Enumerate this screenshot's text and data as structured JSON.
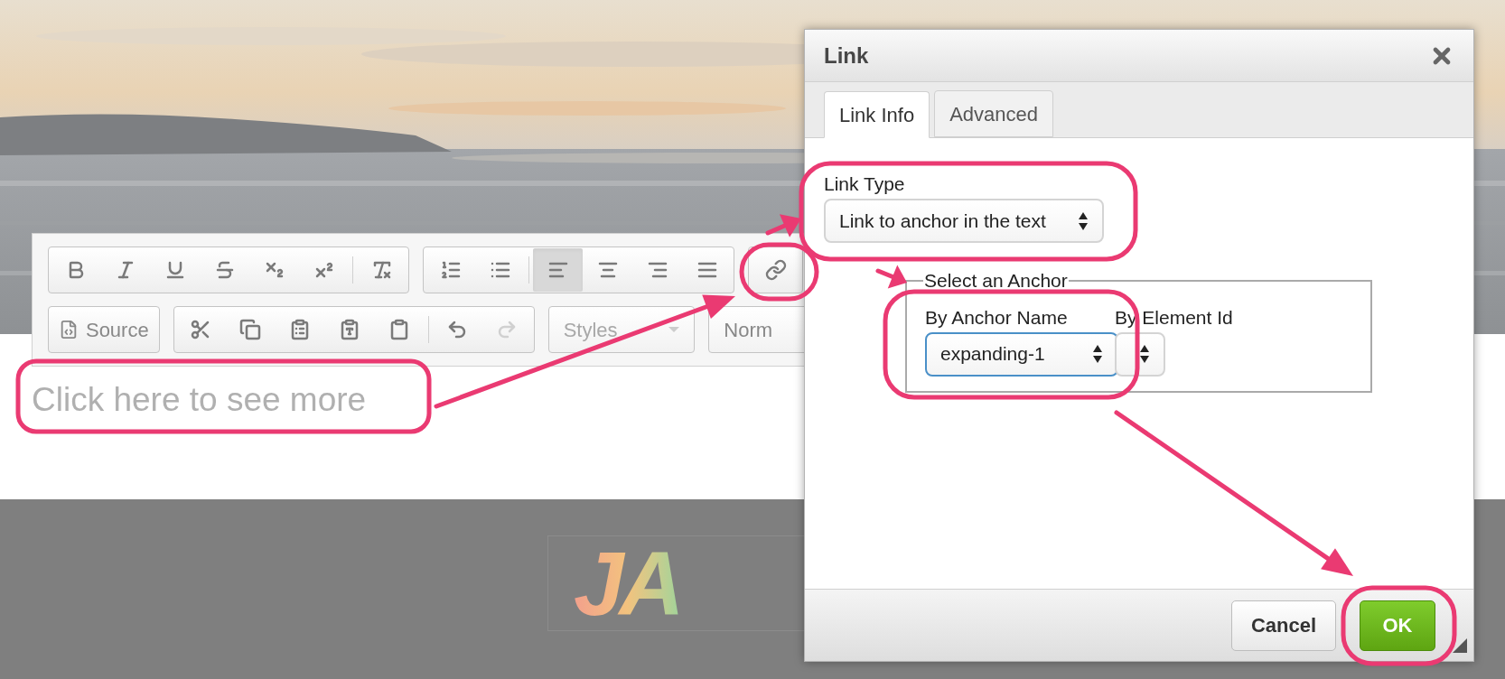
{
  "editor": {
    "toolbar_rows": [
      [
        {
          "items": [
            {
              "kind": "bold",
              "selected": false,
              "disabled": false
            },
            {
              "kind": "italic",
              "selected": false,
              "disabled": false
            },
            {
              "kind": "underline",
              "selected": false,
              "disabled": false
            },
            {
              "kind": "strike",
              "selected": false,
              "disabled": false
            },
            {
              "kind": "subscript",
              "selected": false,
              "disabled": false
            },
            {
              "kind": "superscript",
              "selected": false,
              "disabled": false
            },
            {
              "kind": "separator"
            },
            {
              "kind": "remove-format",
              "selected": false,
              "disabled": false
            }
          ]
        },
        {
          "items": [
            {
              "kind": "numbered-list",
              "selected": false,
              "disabled": false
            },
            {
              "kind": "bulleted-list",
              "selected": false,
              "disabled": false
            },
            {
              "kind": "separator"
            },
            {
              "kind": "align-left",
              "selected": true,
              "disabled": false
            },
            {
              "kind": "align-center",
              "selected": false,
              "disabled": false
            },
            {
              "kind": "align-right",
              "selected": false,
              "disabled": false
            },
            {
              "kind": "justify",
              "selected": false,
              "disabled": false
            }
          ]
        },
        {
          "items": [
            {
              "kind": "link",
              "selected": false,
              "disabled": false
            }
          ]
        }
      ],
      [
        {
          "items": [
            {
              "kind": "source",
              "label": "Source"
            }
          ]
        },
        {
          "items": [
            {
              "kind": "cut",
              "selected": false,
              "disabled": false
            },
            {
              "kind": "copy",
              "selected": false,
              "disabled": false
            },
            {
              "kind": "paste",
              "selected": false,
              "disabled": false
            },
            {
              "kind": "paste-text",
              "selected": false,
              "disabled": false
            },
            {
              "kind": "paste-word",
              "selected": false,
              "disabled": false
            },
            {
              "kind": "separator"
            },
            {
              "kind": "undo",
              "selected": false,
              "disabled": false
            },
            {
              "kind": "redo",
              "selected": false,
              "disabled": true
            }
          ]
        },
        {
          "items": [
            {
              "kind": "combo",
              "label": "Styles",
              "disabled": true,
              "caret": true
            }
          ]
        },
        {
          "items": [
            {
              "kind": "combo",
              "label": "Norm",
              "disabled": false
            }
          ]
        }
      ]
    ],
    "content": "Click here to see more"
  },
  "logo": {
    "text": "JA"
  },
  "dialog": {
    "title": "Link",
    "tabs": [
      {
        "label": "Link Info",
        "selected": true
      },
      {
        "label": "Advanced",
        "selected": false
      }
    ],
    "link_type": {
      "label": "Link Type",
      "value": "Link to anchor in the text"
    },
    "anchor_group": {
      "legend": "Select an Anchor",
      "by_name": {
        "label": "By Anchor Name",
        "value": "expanding-1",
        "focused": true
      },
      "by_id": {
        "label": "By Element Id",
        "focused": false
      }
    },
    "buttons": [
      {
        "label": "Cancel",
        "kind": "secondary"
      },
      {
        "label": "OK",
        "kind": "primary"
      }
    ]
  }
}
